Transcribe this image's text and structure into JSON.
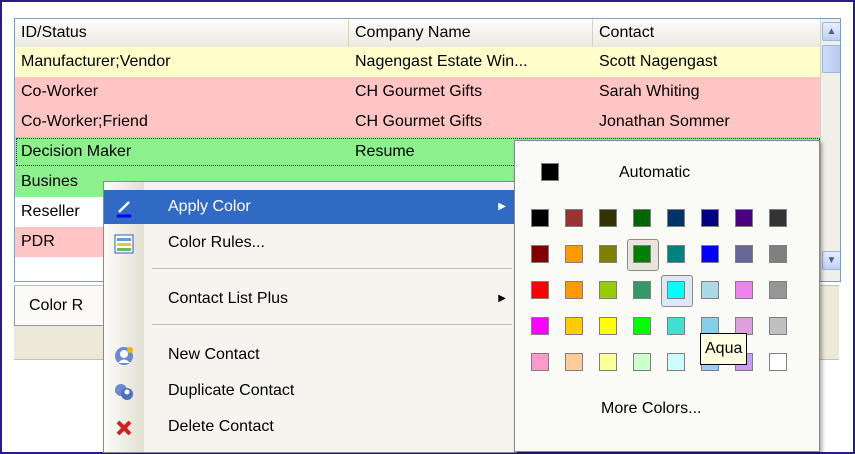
{
  "grid": {
    "columns": [
      "ID/Status",
      "Company Name",
      "Contact"
    ],
    "rows": [
      {
        "status": "Manufacturer;Vendor",
        "company": "Nagengast Estate Win...",
        "contact": "Scott Nagengast",
        "bg": "#ffffcc"
      },
      {
        "status": "Co-Worker",
        "company": "CH Gourmet Gifts",
        "contact": "Sarah Whiting",
        "bg": "#ffc5c5"
      },
      {
        "status": "Co-Worker;Friend",
        "company": "CH Gourmet Gifts",
        "contact": "Jonathan Sommer",
        "bg": "#ffc5c5"
      },
      {
        "status": "Decision Maker",
        "company": "Resume",
        "contact": "",
        "bg": "#8cf08c"
      },
      {
        "status": "Busines",
        "company": "",
        "contact": "",
        "bg": "#8cf08c"
      },
      {
        "status": "Reseller",
        "company": "",
        "contact": "",
        "bg": "#ffffff"
      },
      {
        "status": "PDR",
        "company": "",
        "contact": "",
        "bg": "#ffc5c5"
      }
    ],
    "tab_label": "Color R"
  },
  "context_menu": {
    "apply_color": "Apply Color",
    "color_rules": "Color Rules...",
    "contact_list_plus": "Contact List Plus",
    "new_contact": "New Contact",
    "duplicate_contact": "Duplicate Contact",
    "delete_contact": "Delete Contact",
    "submenu_arrow": "▶"
  },
  "color_picker": {
    "automatic_label": "Automatic",
    "more_colors_label": "More Colors...",
    "tooltip": "Aqua",
    "selected_color_name": "Aqua",
    "colors": [
      [
        "#000000",
        "#993333",
        "#333300",
        "#003300",
        "#003366",
        "#000080",
        "#333399",
        "#333333"
      ],
      [
        "#800000",
        "#ff6600",
        "#808000",
        "#008000",
        "#008080",
        "#0000ff",
        "#666699",
        "#808080"
      ],
      [
        "#ff0000",
        "#ff9900",
        "#99cc00",
        "#339966",
        "#33cccc",
        "#3366ff",
        "#800080",
        "#969696"
      ],
      [
        "#ff00ff",
        "#ffcc00",
        "#ffff00",
        "#00ff00",
        "#00ffff",
        "#00ccff",
        "#993366",
        "#c0c0c0"
      ],
      [
        "#ff99cc",
        "#ffcc99",
        "#ffff99",
        "#ccffcc",
        "#ccffff",
        "#99ccff",
        "#cc99ff",
        "#ffffff"
      ]
    ],
    "colors_visible": [
      [
        "#000000",
        "#993333",
        "#333300",
        "#006600",
        "#003366",
        "#000080",
        "#4b0082",
        "#333333"
      ],
      [
        "#800000",
        "#ff9900",
        "#808000",
        "#008000",
        "#008080",
        "#0000ff",
        "#666699",
        "#808080"
      ],
      [
        "#ff0000",
        "#ff9900",
        "#99cc00",
        "#339966",
        "#00ffff",
        "#add8e6",
        "#ee82ee",
        "#969696"
      ],
      [
        "#ff00ff",
        "#ffcc00",
        "#ffff00",
        "#00ff00",
        "#40e0d0",
        "#87ceeb",
        "#dda0dd",
        "#c0c0c0"
      ],
      [
        "#ff99cc",
        "#ffcc99",
        "#ffff99",
        "#ccffcc",
        "#ccffff",
        "#99ccff",
        "#cc99ff",
        "#ffffff"
      ]
    ]
  }
}
